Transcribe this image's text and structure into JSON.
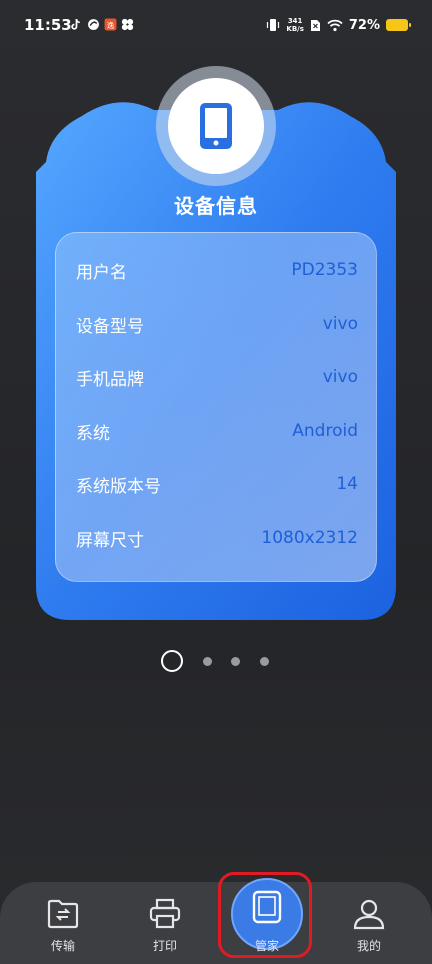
{
  "status_bar": {
    "time": "11:53",
    "net_speed_value": "341",
    "net_speed_unit": "KB/s",
    "battery": "72%",
    "icons": [
      "tiktok-icon",
      "app-icon",
      "app-badge-icon",
      "fan-icon",
      "vibrate-icon",
      "sim-icon",
      "wifi-icon",
      "battery-icon"
    ]
  },
  "card": {
    "title": "设备信息",
    "icon": "tablet-icon",
    "rows": [
      {
        "label": "用户名",
        "value": "PD2353"
      },
      {
        "label": "设备型号",
        "value": "vivo"
      },
      {
        "label": "手机品牌",
        "value": "vivo"
      },
      {
        "label": "系统",
        "value": "Android"
      },
      {
        "label": "系统版本号",
        "value": "14"
      },
      {
        "label": "屏幕尺寸",
        "value": "1080x2312"
      }
    ]
  },
  "pager": {
    "pages": 4,
    "active_index": 0
  },
  "bottom_nav": {
    "items": [
      {
        "label": "传输",
        "icon": "folder-transfer-icon"
      },
      {
        "label": "打印",
        "icon": "printer-icon"
      },
      {
        "label": "管家",
        "icon": "tablet-icon",
        "active": true
      },
      {
        "label": "我的",
        "icon": "user-icon"
      }
    ]
  },
  "colors": {
    "card_blue": "#2f7cf0",
    "value_blue": "#1f5fd6",
    "highlight_red": "#e01b24",
    "nav_bg": "#3d3e42"
  }
}
